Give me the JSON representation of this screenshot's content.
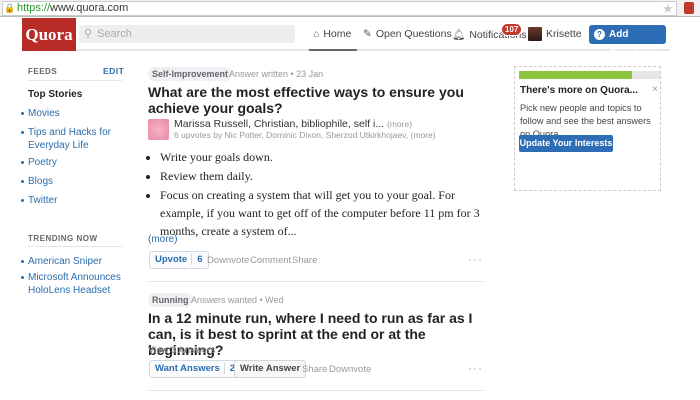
{
  "browser": {
    "url_scheme": "https://",
    "url_rest": "www.quora.com"
  },
  "header": {
    "logo": "Quora",
    "search_placeholder": "Search",
    "nav": {
      "home": "Home",
      "open_questions": "Open Questions",
      "notifications": "Notifications",
      "notifications_count": "107",
      "user": "Krisette"
    },
    "add_question": "Add Question"
  },
  "sidebar": {
    "feeds_label": "FEEDS",
    "edit": "EDIT",
    "top_stories": "Top Stories",
    "feeds": [
      "Movies",
      "Tips and Hacks for Everyday Life",
      "Poetry",
      "Blogs",
      "Twitter"
    ],
    "trending_label": "TRENDING NOW",
    "trending": [
      "American Sniper",
      "Microsoft Announces HoloLens Headset"
    ]
  },
  "feed": [
    {
      "topic": "Self-Improvement",
      "meta": "Answer written • 23 Jan",
      "title": "What are the most effective ways to ensure you achieve your goals?",
      "authors": "Marissa Russell, Christian, bibliophile, self i...",
      "authors_more": "(more)",
      "upvoters": "6 upvotes by Nic Potter, Dominic Dixon, Sherzod Utkirkhojaev,",
      "upvoters_more": "(more)",
      "bullets": [
        "Write your goals down.",
        "Review them daily.",
        "Focus on creating a system that will get you to your goal. For example, if you want to get off of the computer before 11 pm for 3 months, create a system of..."
      ],
      "more": "(more)",
      "upvote": "Upvote",
      "upvote_count": "6",
      "downvote": "Downvote",
      "comment": "Comment",
      "share": "Share"
    },
    {
      "topic": "Running",
      "meta": "Answers wanted • Wed",
      "title": "In a 12 minute run, where I need to run as far as I can, is it best to sprint at the end or at the beginning?",
      "view_answers": "View 3 Answers",
      "want_answers": "Want Answers",
      "want_count": "2",
      "write_answer": "Write Answer",
      "share": "Share",
      "downvote": "Downvote"
    }
  ],
  "promo": {
    "progress": 0.8,
    "title": "There's more on Quora...",
    "close": "×",
    "text": "Pick new people and topics to follow and see the best answers on Quora.",
    "button": "Update Your Interests",
    "accent": "#8cc63f"
  }
}
